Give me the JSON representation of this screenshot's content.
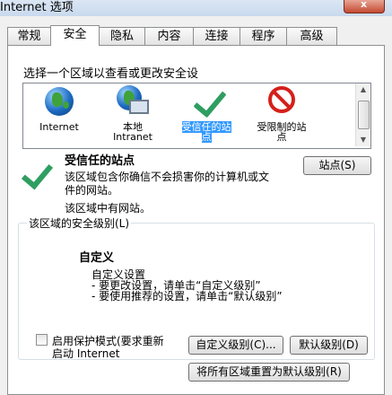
{
  "window": {
    "title": "Internet 选项"
  },
  "tabs": [
    "常规",
    "安全",
    "隐私",
    "内容",
    "连接",
    "程序",
    "高级"
  ],
  "active_tab": "安全",
  "zone_prompt": "选择一个区域以查看或更改安全设",
  "zones": [
    {
      "label": "Internet",
      "icon": "globe-icon"
    },
    {
      "label": "本地\nIntranet",
      "icon": "local-intranet-icon"
    },
    {
      "label": "受信任的站\n点",
      "icon": "checkmark-icon",
      "selected": true
    },
    {
      "label": "受限制的站\n点",
      "icon": "restricted-icon"
    }
  ],
  "selected_zone": {
    "title": "受信任的站点",
    "desc_line1": "该区域包含你确信不会损害你的计算机或文",
    "desc_line2": "件的网站。",
    "has_sites": "该区域中有网站。",
    "sites_button": "站点(S)"
  },
  "security_level": {
    "legend": "该区域的安全级别(L)",
    "heading": "自定义",
    "line1": "自定义设置",
    "line2": "- 要更改设置，请单击“自定义级别”",
    "line3": "- 要使用推荐的设置，请单击“默认级别”"
  },
  "protected_mode": {
    "label_line1": "启用保护模式(要求重新",
    "label_line2": "启动 Internet",
    "checked": false
  },
  "buttons": {
    "custom_level": "自定义级别(C)...",
    "default_level": "默认级别(D)",
    "reset_all": "将所有区域重置为默认级别(R)"
  }
}
